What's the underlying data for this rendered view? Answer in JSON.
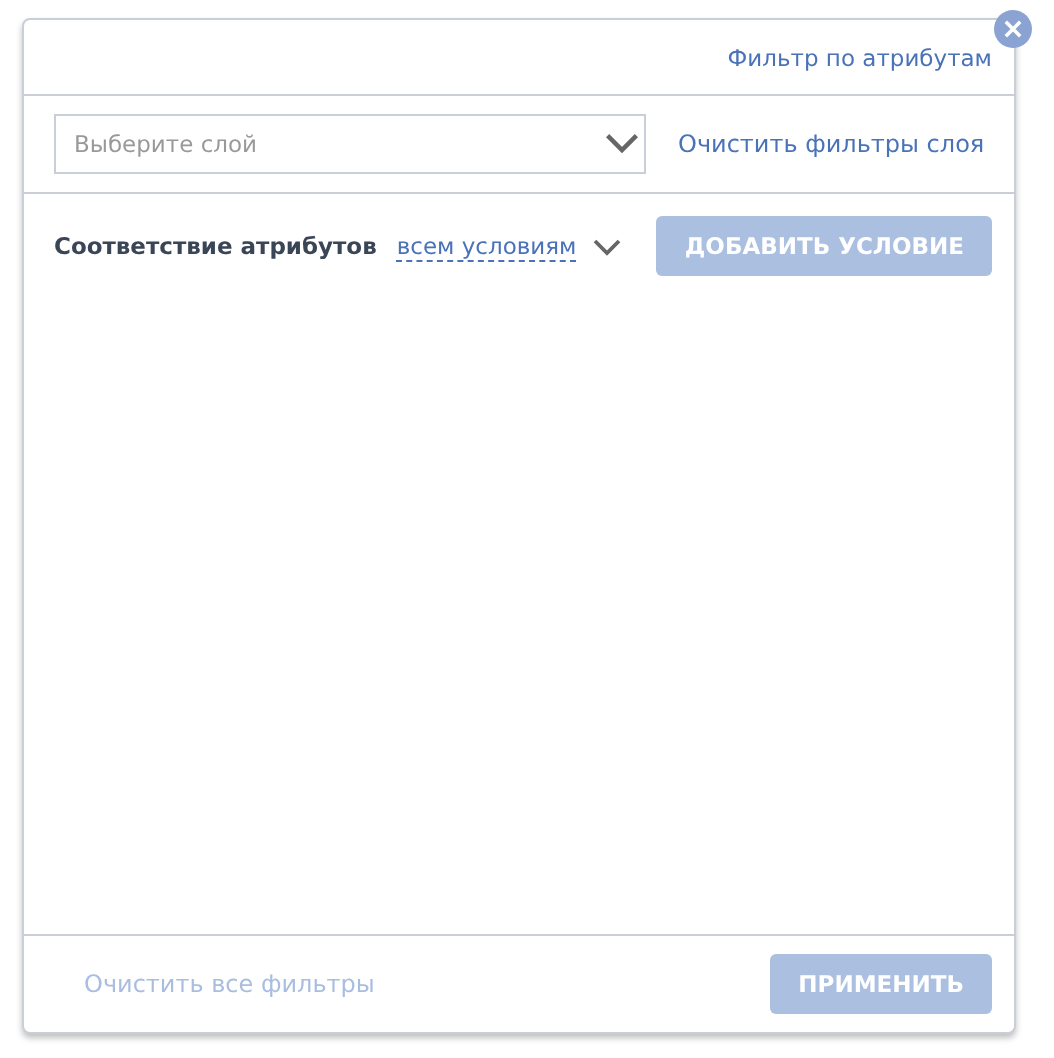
{
  "header": {
    "title": "Фильтр по атрибутам"
  },
  "layer_select": {
    "placeholder": "Выберите слой"
  },
  "clear_layer_link": {
    "label": "Очистить фильтры слоя",
    "disabled": false
  },
  "match": {
    "label": "Соответствие атрибутов",
    "value": "всем условиям"
  },
  "add_button": {
    "label": "ДОБАВИТЬ УСЛОВИЕ",
    "disabled": true
  },
  "footer": {
    "clear_all": {
      "label": "Очистить все фильтры",
      "disabled": true
    },
    "apply": {
      "label": "ПРИМЕНИТЬ",
      "disabled": true
    }
  }
}
